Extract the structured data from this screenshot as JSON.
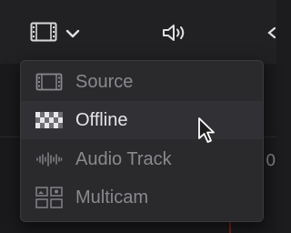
{
  "toolbar": {
    "icons": [
      "clip-display-icon",
      "chevron-down-icon",
      "speaker-icon"
    ]
  },
  "menu": {
    "items": [
      {
        "label": "Source",
        "icon": "film-frame-icon",
        "state": "disabled"
      },
      {
        "label": "Offline",
        "icon": "checkerboard-icon",
        "state": "hovered"
      },
      {
        "label": "Audio Track",
        "icon": "waveform-icon",
        "state": "disabled"
      },
      {
        "label": "Multicam",
        "icon": "multicam-grid-icon",
        "state": "disabled"
      }
    ]
  },
  "background": {
    "edge_text": "0"
  },
  "colors": {
    "menu_bg": "#2a2a2d",
    "hover_bg": "#313135",
    "text_bright": "#e6e6e8",
    "text_dim": "#8a8a8e"
  }
}
